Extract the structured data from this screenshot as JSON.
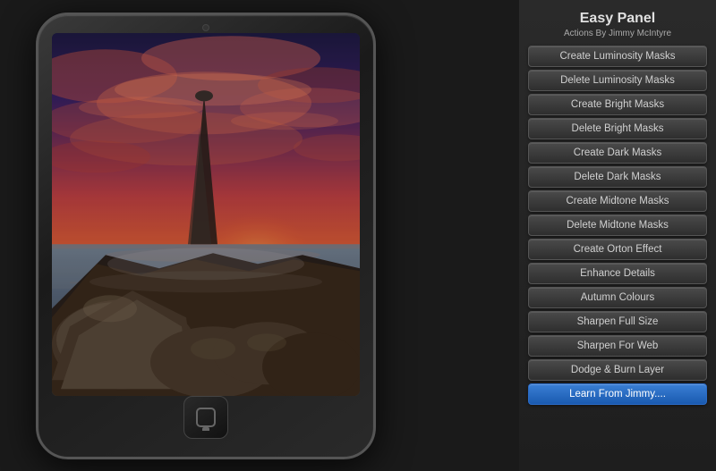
{
  "panel": {
    "title": "Easy Panel",
    "subtitle": "Actions By Jimmy McIntyre",
    "buttons": [
      {
        "id": "create-luminosity-masks",
        "label": "Create Luminosity Masks",
        "highlight": false
      },
      {
        "id": "delete-luminosity-masks",
        "label": "Delete Luminosity Masks",
        "highlight": false
      },
      {
        "id": "create-bright-masks",
        "label": "Create Bright Masks",
        "highlight": false
      },
      {
        "id": "delete-bright-masks",
        "label": "Delete Bright Masks",
        "highlight": false
      },
      {
        "id": "create-dark-masks",
        "label": "Create Dark Masks",
        "highlight": false
      },
      {
        "id": "delete-dark-masks",
        "label": "Delete Dark Masks",
        "highlight": false
      },
      {
        "id": "create-midtone-masks",
        "label": "Create Midtone Masks",
        "highlight": false
      },
      {
        "id": "delete-midtone-masks",
        "label": "Delete Midtone Masks",
        "highlight": false
      },
      {
        "id": "create-orton-effect",
        "label": "Create Orton Effect",
        "highlight": false
      },
      {
        "id": "enhance-details",
        "label": "Enhance Details",
        "highlight": false
      },
      {
        "id": "autumn-colours",
        "label": "Autumn Colours",
        "highlight": false
      },
      {
        "id": "sharpen-full-size",
        "label": "Sharpen Full Size",
        "highlight": false
      },
      {
        "id": "sharpen-for-web",
        "label": "Sharpen For Web",
        "highlight": false
      },
      {
        "id": "dodge-burn-layer",
        "label": "Dodge & Burn Layer",
        "highlight": false
      },
      {
        "id": "learn-from-jimmy",
        "label": "Learn From Jimmy....",
        "highlight": true
      }
    ]
  },
  "ipad": {
    "home_button_aria": "Home"
  }
}
